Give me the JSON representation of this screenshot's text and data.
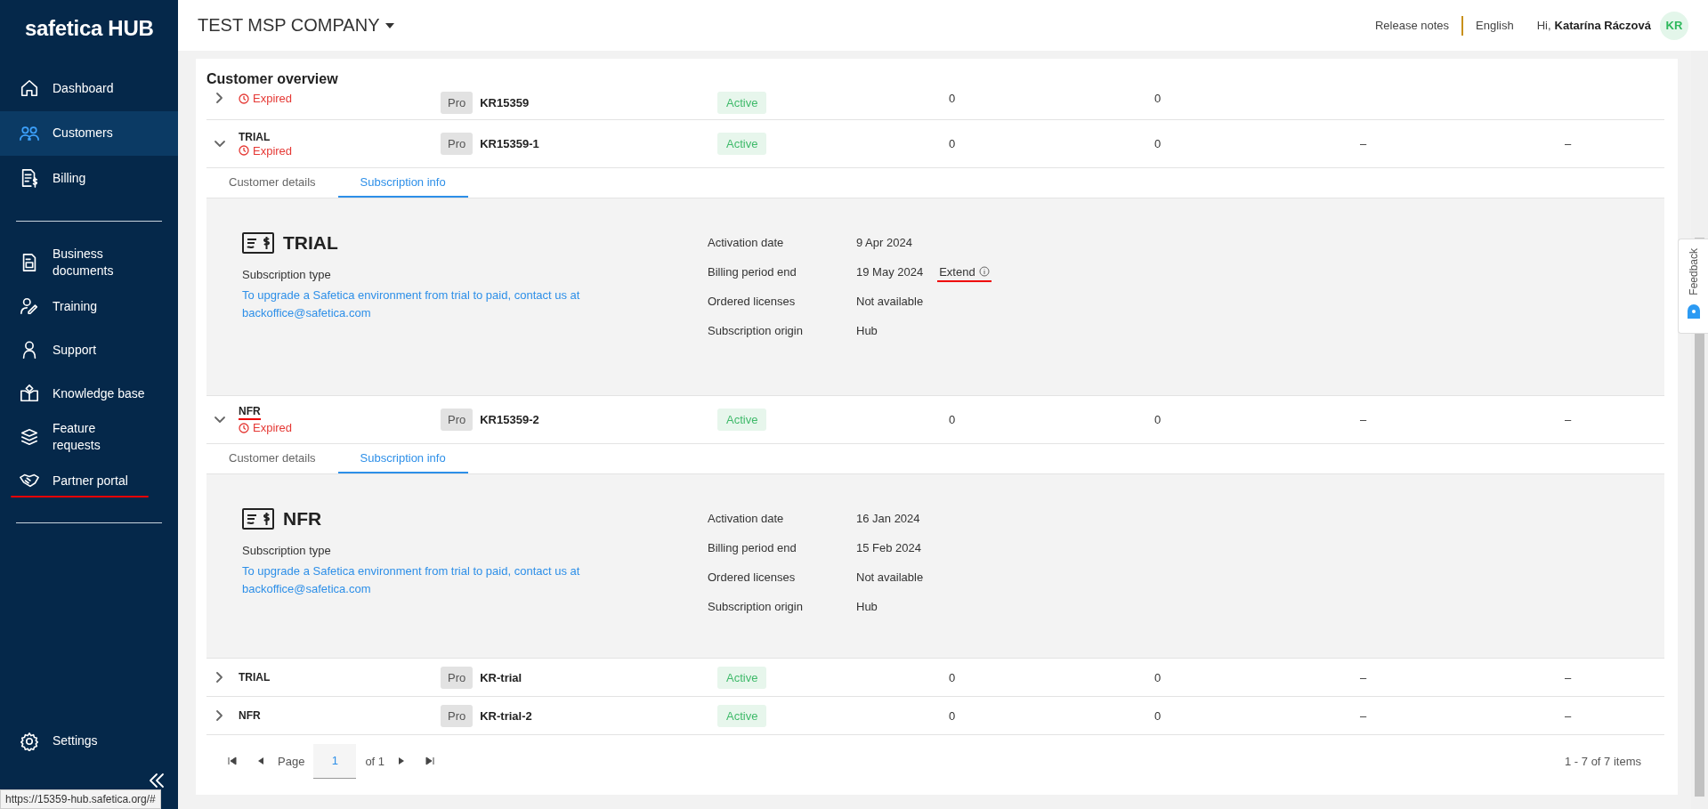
{
  "sidebar": {
    "logo": "safetica HUB",
    "sections": [
      {
        "items": [
          {
            "label": "Dashboard",
            "selected": false,
            "annotated": false
          },
          {
            "label": "Customers",
            "selected": true,
            "annotated": false
          },
          {
            "label": "Billing",
            "selected": false,
            "annotated": false
          }
        ]
      },
      {
        "items": [
          {
            "label": "Business documents",
            "selected": false,
            "annotated": false
          },
          {
            "label": "Training",
            "selected": false,
            "annotated": false
          },
          {
            "label": "Support",
            "selected": false,
            "annotated": false
          },
          {
            "label": "Knowledge base",
            "selected": false,
            "annotated": false
          },
          {
            "label": "Feature requests",
            "selected": false,
            "annotated": false
          },
          {
            "label": "Partner portal",
            "selected": false,
            "annotated": true
          }
        ]
      },
      {
        "items": [
          {
            "label": "Settings",
            "selected": false,
            "annotated": false
          }
        ]
      }
    ]
  },
  "header": {
    "company": "TEST MSP COMPANY",
    "links": [
      "Release notes",
      "English"
    ],
    "greeting": "Hi,",
    "user": "Katarína Ráczová",
    "avatar": "KR"
  },
  "page": {
    "title": "Customer overview"
  },
  "rows": [
    {
      "partial": true,
      "status": "Expired",
      "edition": "Pro",
      "code": "KR15359",
      "state": "Active",
      "values": [
        "0",
        "0"
      ],
      "expanded": false
    },
    {
      "partial": false,
      "name": "TRIAL",
      "status": "Expired",
      "edition": "Pro",
      "code": "KR15359-1",
      "state": "Active",
      "values": [
        "0",
        "0",
        "–",
        "–"
      ],
      "expanded": true,
      "annotated": false,
      "tabs": [
        {
          "label": "Customer details",
          "selected": false
        },
        {
          "label": "Subscription info",
          "selected": true
        }
      ],
      "details": {
        "type": "TRIAL",
        "type_label": "Subscription type",
        "note": "To upgrade a Safetica environment from trial to paid, contact us at backoffice@safetica.com",
        "fields": [
          {
            "label": "Activation date",
            "value": "9 Apr 2024"
          },
          {
            "label": "Billing period end",
            "value": "19 May 2024",
            "action": {
              "label": "Extend",
              "annotated": true
            }
          },
          {
            "label": "Ordered licenses",
            "value": "Not available"
          },
          {
            "label": "Subscription origin",
            "value": "Hub"
          }
        ]
      }
    },
    {
      "partial": false,
      "name": "NFR",
      "status": "Expired",
      "edition": "Pro",
      "code": "KR15359-2",
      "state": "Active",
      "values": [
        "0",
        "0",
        "–",
        "–"
      ],
      "expanded": true,
      "annotated": true,
      "tabs": [
        {
          "label": "Customer details",
          "selected": false
        },
        {
          "label": "Subscription info",
          "selected": true
        }
      ],
      "details": {
        "type": "NFR",
        "type_label": "Subscription type",
        "note": "To upgrade a Safetica environment from trial to paid, contact us at backoffice@safetica.com",
        "fields": [
          {
            "label": "Activation date",
            "value": "16 Jan 2024"
          },
          {
            "label": "Billing period end",
            "value": "15 Feb 2024"
          },
          {
            "label": "Ordered licenses",
            "value": "Not available"
          },
          {
            "label": "Subscription origin",
            "value": "Hub"
          }
        ]
      }
    },
    {
      "partial": false,
      "name": "TRIAL",
      "edition": "Pro",
      "code": "KR-trial",
      "state": "Active",
      "values": [
        "0",
        "0",
        "–",
        "–"
      ],
      "expanded": false,
      "annotated": false
    },
    {
      "partial": false,
      "name": "NFR",
      "edition": "Pro",
      "code": "KR-trial-2",
      "state": "Active",
      "values": [
        "0",
        "0",
        "–",
        "–"
      ],
      "expanded": false,
      "annotated": false
    }
  ],
  "pagination": {
    "page_label": "Page",
    "page": "1",
    "of": "of 1",
    "summary": "1 - 7 of 7 items"
  },
  "feedback": {
    "label": "Feedback"
  },
  "status_url": "https://15359-hub.safetica.org/#"
}
